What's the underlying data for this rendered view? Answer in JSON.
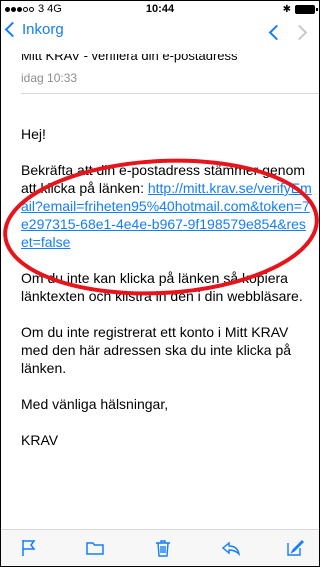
{
  "status_bar": {
    "carrier": "3",
    "network": "4G",
    "time": "10:44"
  },
  "nav": {
    "back_label": "Inkorg"
  },
  "email": {
    "subject": "Mitt KRAV - verifiera din e-postadress",
    "date": "idag 10:33",
    "greeting": "Hej!",
    "instruction": "Bekräfta att din e-postadress stämmer genom att klicka på länken:",
    "link": "http://mitt.krav.se/verifyEmail?email=friheten95%40hotmail.com&token=7e297315-68e1-4e4e-b967-9f198579e854&reset=false",
    "copy_instruction": "Om du inte kan klicka på länken så kopiera länktexten och klistra in den i din webbläsare.",
    "not_registered": "Om du inte registrerat ett konto i Mitt KRAV med den här adressen ska du inte klicka på länken.",
    "closing": "Med vänliga hälsningar,",
    "signature": "KRAV"
  },
  "toolbar": {
    "icons": [
      "flag-icon",
      "folder-icon",
      "trash-icon",
      "reply-icon",
      "compose-icon"
    ]
  },
  "colors": {
    "accent": "#147efb",
    "annotation": "#e8141b"
  }
}
